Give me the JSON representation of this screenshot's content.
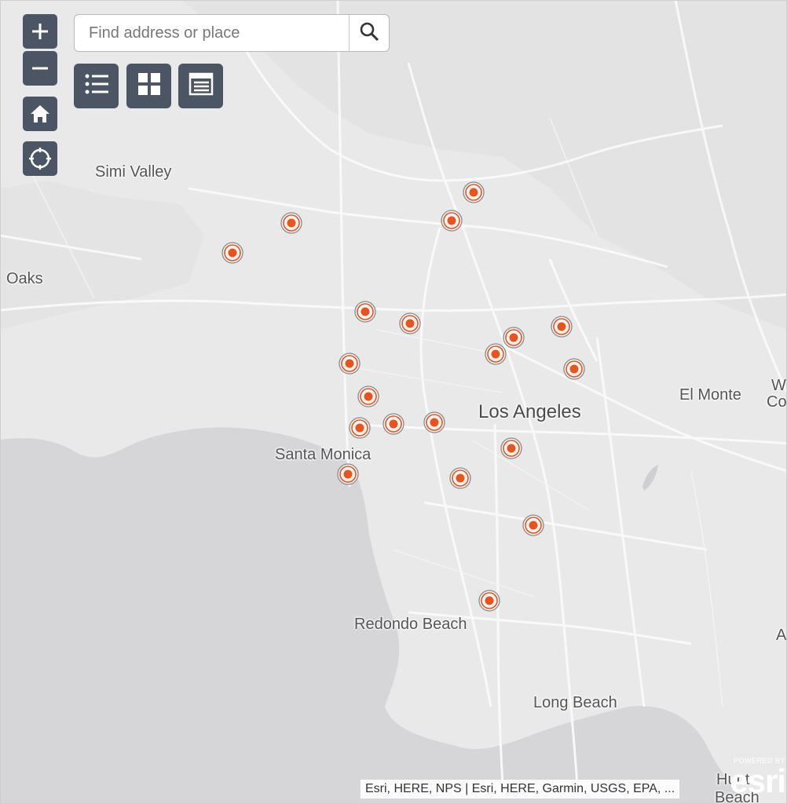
{
  "search": {
    "placeholder": "Find address or place"
  },
  "zoom": {
    "in_symbol": "+",
    "out_symbol": "−"
  },
  "controls": {
    "home_icon": "home-icon",
    "locate_icon": "locate-icon",
    "legend_icon": "legend-list-icon",
    "basemap_icon": "basemap-gallery-icon",
    "table_icon": "attribute-table-icon"
  },
  "colors": {
    "marker": "#e8541d",
    "control_bg": "#4b5563",
    "water": "#d7d7da",
    "land": "#e8e8e8"
  },
  "labels": [
    {
      "text": "Simi Valley",
      "size": "normal"
    },
    {
      "text": "Oaks",
      "size": "normal"
    },
    {
      "text": "Los Angeles",
      "size": "big"
    },
    {
      "text": "El Monte",
      "size": "normal"
    },
    {
      "text": "W",
      "size": "normal"
    },
    {
      "text": "Co",
      "size": "normal"
    },
    {
      "text": "Santa Monica",
      "size": "normal"
    },
    {
      "text": "Redondo Beach",
      "size": "normal"
    },
    {
      "text": "Long Beach",
      "size": "normal"
    },
    {
      "text": "Hunt",
      "size": "normal"
    },
    {
      "text": "Beach",
      "size": "normal"
    },
    {
      "text": "A",
      "size": "normal"
    }
  ],
  "marker_count": 22,
  "attribution": "Esri, HERE, NPS | Esri, HERE, Garmin, USGS, EPA, ...",
  "logo": {
    "powered": "POWERED BY",
    "brand": "esri"
  }
}
